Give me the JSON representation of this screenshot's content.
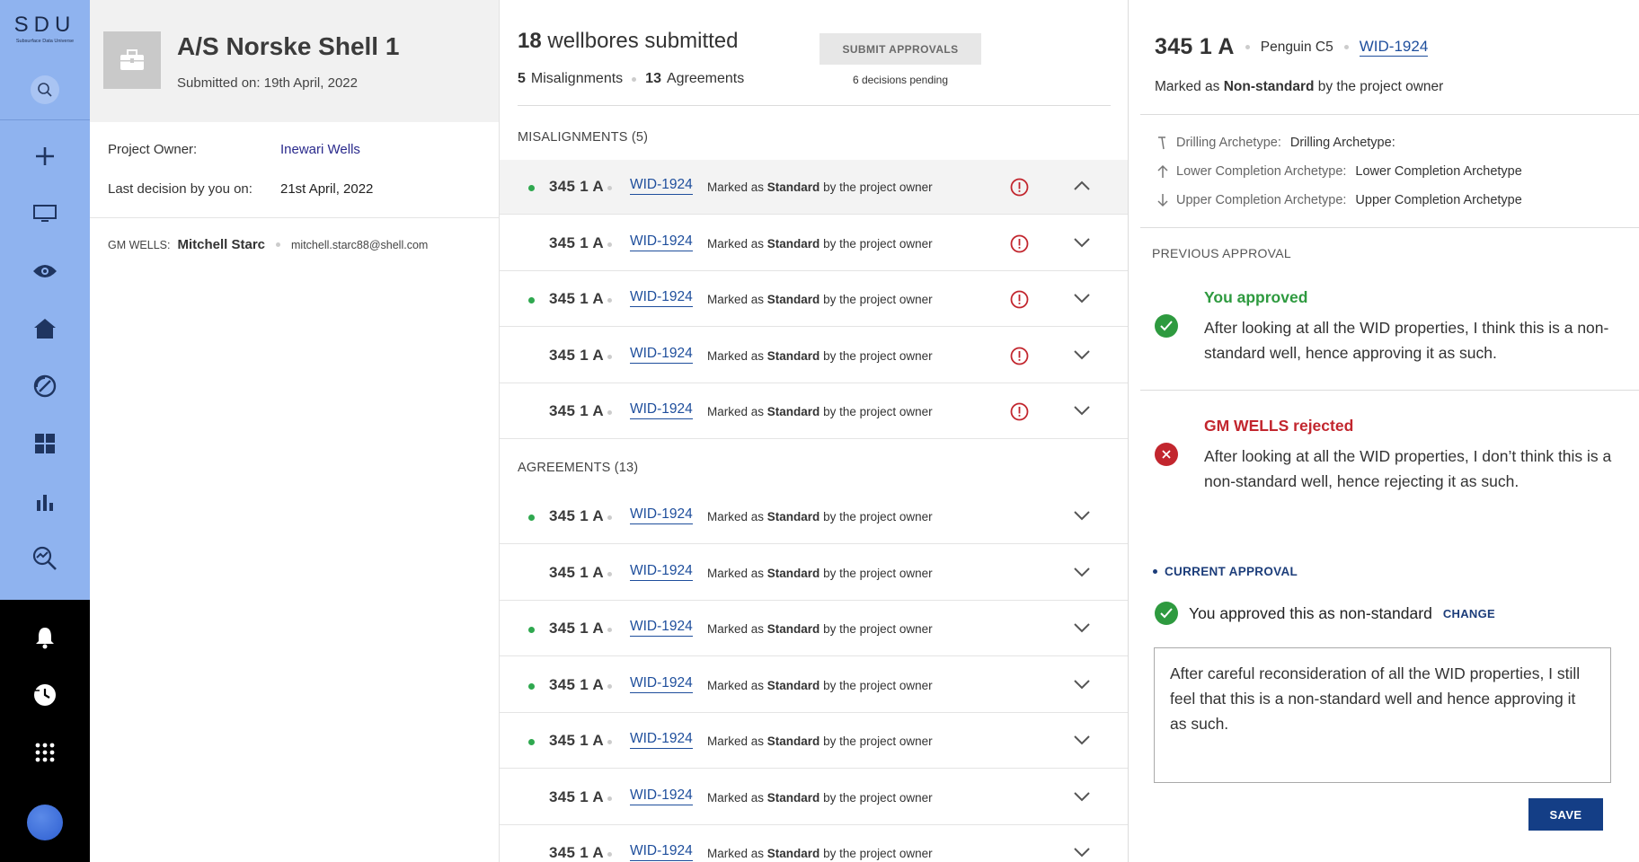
{
  "app": {
    "logo": "SDU",
    "logo_sub": "Subsurface Data Universe"
  },
  "nav": {
    "top": [
      "search-icon",
      "plus-icon",
      "monitor-icon",
      "eye-icon",
      "home-icon",
      "gauge-icon",
      "grid-icon",
      "bar-chart-icon",
      "analytics-search-icon"
    ],
    "bottom": [
      "bell-icon",
      "history-icon",
      "apps-icon",
      "avatar"
    ]
  },
  "project": {
    "title": "A/S Norske Shell 1",
    "submitted": "Submitted on: 19th April, 2022",
    "owner_label": "Project Owner:",
    "owner_value": "Inewari Wells",
    "last_label": "Last decision by you on:",
    "last_value": "21st April, 2022",
    "gm_label": "GM WELLS:",
    "gm_name": "Mitchell Starc",
    "gm_email": "mitchell.starc88@shell.com"
  },
  "list": {
    "count": "18",
    "title_rest": "wellbores submitted",
    "mis_count": "5",
    "mis_label": "Misalignments",
    "agr_count": "13",
    "agr_label": "Agreements",
    "submit_label": "SUBMIT APPROVALS",
    "pending": "6 decisions pending",
    "mis_head": "MISALIGNMENTS (5)",
    "agr_head": "AGREEMENTS (13)",
    "row_prefix": "Marked as",
    "row_bold": "Standard",
    "row_suffix": "by the project owner",
    "misalignments": [
      {
        "name": "345 1 A",
        "wid": "WID-1924",
        "dot": true,
        "expanded": true
      },
      {
        "name": "345 1 A",
        "wid": "WID-1924",
        "dot": false,
        "expanded": false
      },
      {
        "name": "345 1 A",
        "wid": "WID-1924",
        "dot": true,
        "expanded": false
      },
      {
        "name": "345 1 A",
        "wid": "WID-1924",
        "dot": false,
        "expanded": false
      },
      {
        "name": "345 1 A",
        "wid": "WID-1924",
        "dot": false,
        "expanded": false
      }
    ],
    "agreements": [
      {
        "name": "345 1 A",
        "wid": "WID-1924",
        "dot": true
      },
      {
        "name": "345 1 A",
        "wid": "WID-1924",
        "dot": false
      },
      {
        "name": "345 1 A",
        "wid": "WID-1924",
        "dot": true
      },
      {
        "name": "345 1 A",
        "wid": "WID-1924",
        "dot": true
      },
      {
        "name": "345 1 A",
        "wid": "WID-1924",
        "dot": true
      },
      {
        "name": "345 1 A",
        "wid": "WID-1924",
        "dot": false
      },
      {
        "name": "345 1 A",
        "wid": "WID-1924",
        "dot": false
      }
    ]
  },
  "detail": {
    "name": "345 1 A",
    "field": "Penguin C5",
    "wid": "WID-1924",
    "marked_prefix": "Marked as",
    "marked_bold": "Non-standard",
    "marked_suffix": "by the project owner",
    "archetypes": [
      {
        "icon": "drill-icon",
        "key": "Drilling Archetype:",
        "value": "Drilling Archetype:"
      },
      {
        "icon": "arrow-up-icon",
        "key": "Lower Completion Archetype:",
        "value": "Lower Completion Archetype"
      },
      {
        "icon": "arrow-down-icon",
        "key": "Upper Completion Archetype:",
        "value": "Upper Completion Archetype"
      }
    ],
    "prev_head": "PREVIOUS APPROVAL",
    "approved_title": "You approved",
    "approved_text": "After looking at all the WID properties, I think this is a non-standard well, hence approving it as such.",
    "rejected_title": "GM WELLS rejected",
    "rejected_text": "After looking at all the WID properties, I don’t think this is a non-standard well, hence rejecting it as such.",
    "current_head": "CURRENT APPROVAL",
    "current_text": "You approved this as non-standard",
    "change_label": "CHANGE",
    "note": "After careful reconsideration of all the WID properties, I still feel that this is a non-standard well and hence approving it as such.",
    "save_label": "SAVE"
  },
  "colors": {
    "rail": "#8fb3ef",
    "rail_bottom": "#000000",
    "link": "#1e4e9c",
    "approve": "#2e9a3f",
    "reject": "#c2262e",
    "accent": "#143e86",
    "status_dot": "#2fa84f"
  }
}
